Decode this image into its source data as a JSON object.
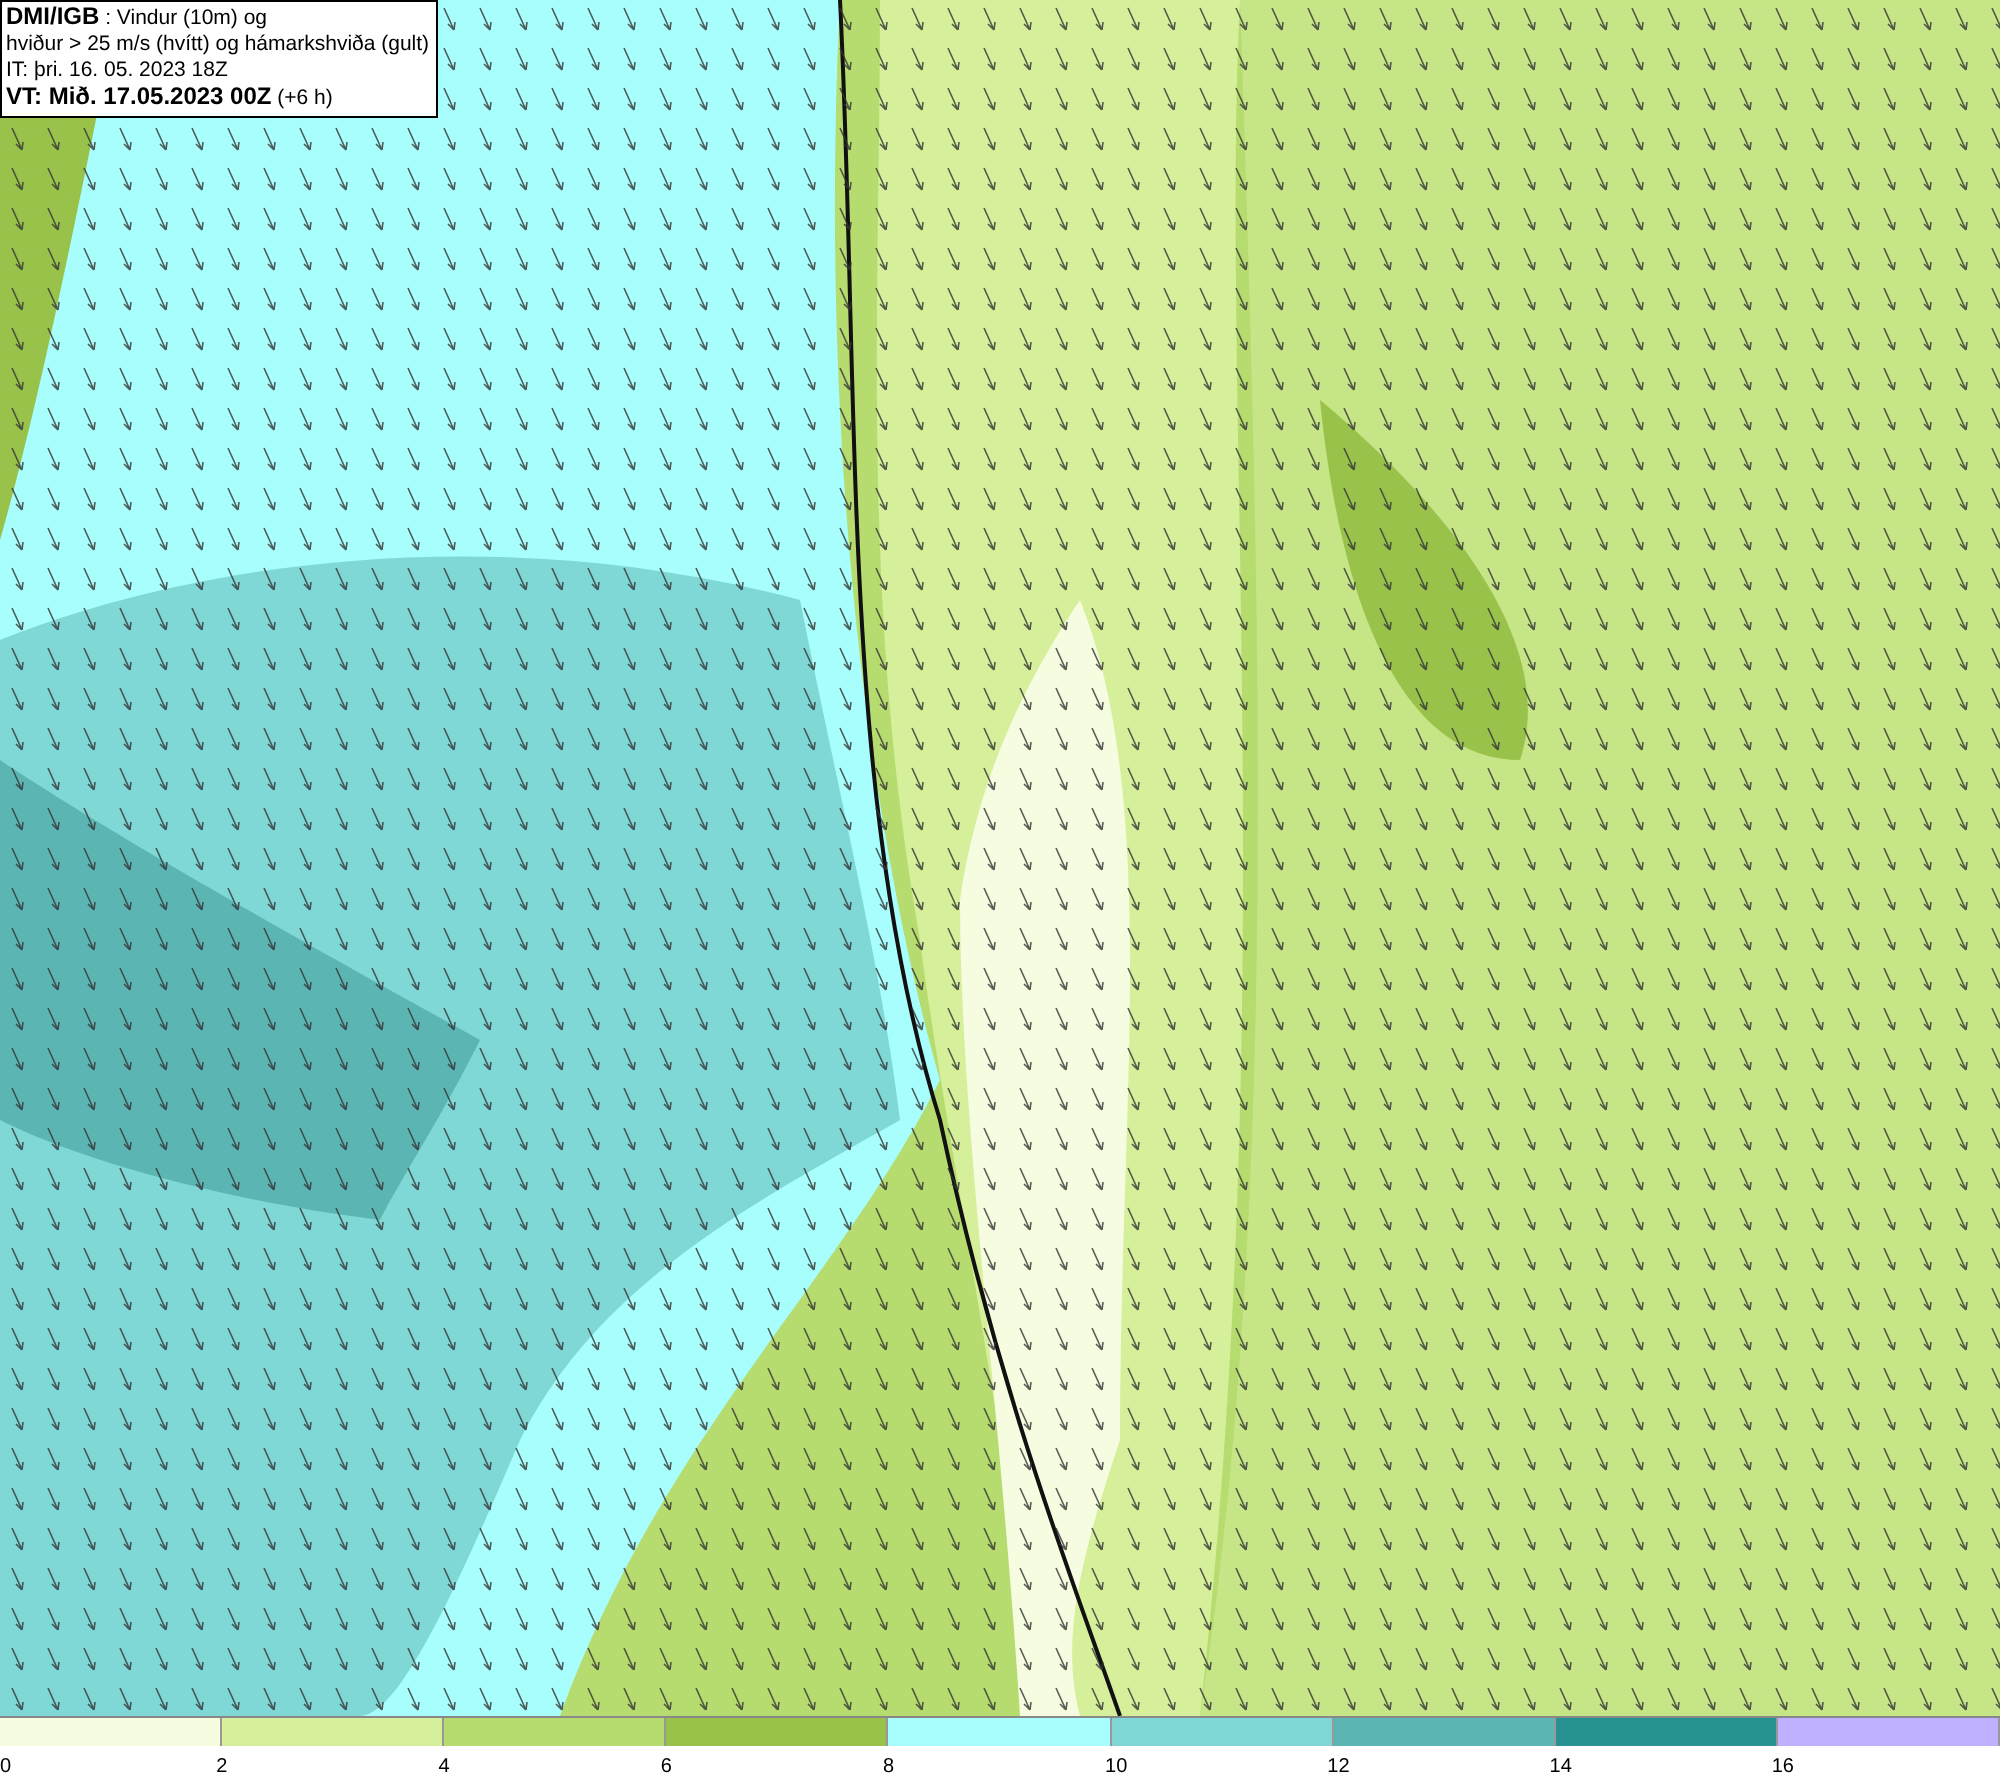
{
  "title_box": {
    "lines": [
      "**DMI/IGB** : Vindur (10m) og",
      "hviður > 25 m/s (hvítt) og hámarkshviða (gult)",
      "IT: þri. 16. 05. 2023 18Z",
      "**VT: Mið. 17.05.2023 00Z** (+6 h)"
    ]
  },
  "legend": [
    {
      "label": "0",
      "color": "#f5fce0"
    },
    {
      "label": "2",
      "color": "#d5ef9a"
    },
    {
      "label": "4",
      "color": "#b6db6e"
    },
    {
      "label": "6",
      "color": "#98c24a"
    },
    {
      "label": "8",
      "color": "#a8fefc"
    },
    {
      "label": "10",
      "color": "#7fd8d6"
    },
    {
      "label": "12",
      "color": "#5bb5b3"
    },
    {
      "label": "14",
      "color": "#27928f"
    },
    {
      "label": "16",
      "color": "#c1b0ff"
    }
  ]
}
